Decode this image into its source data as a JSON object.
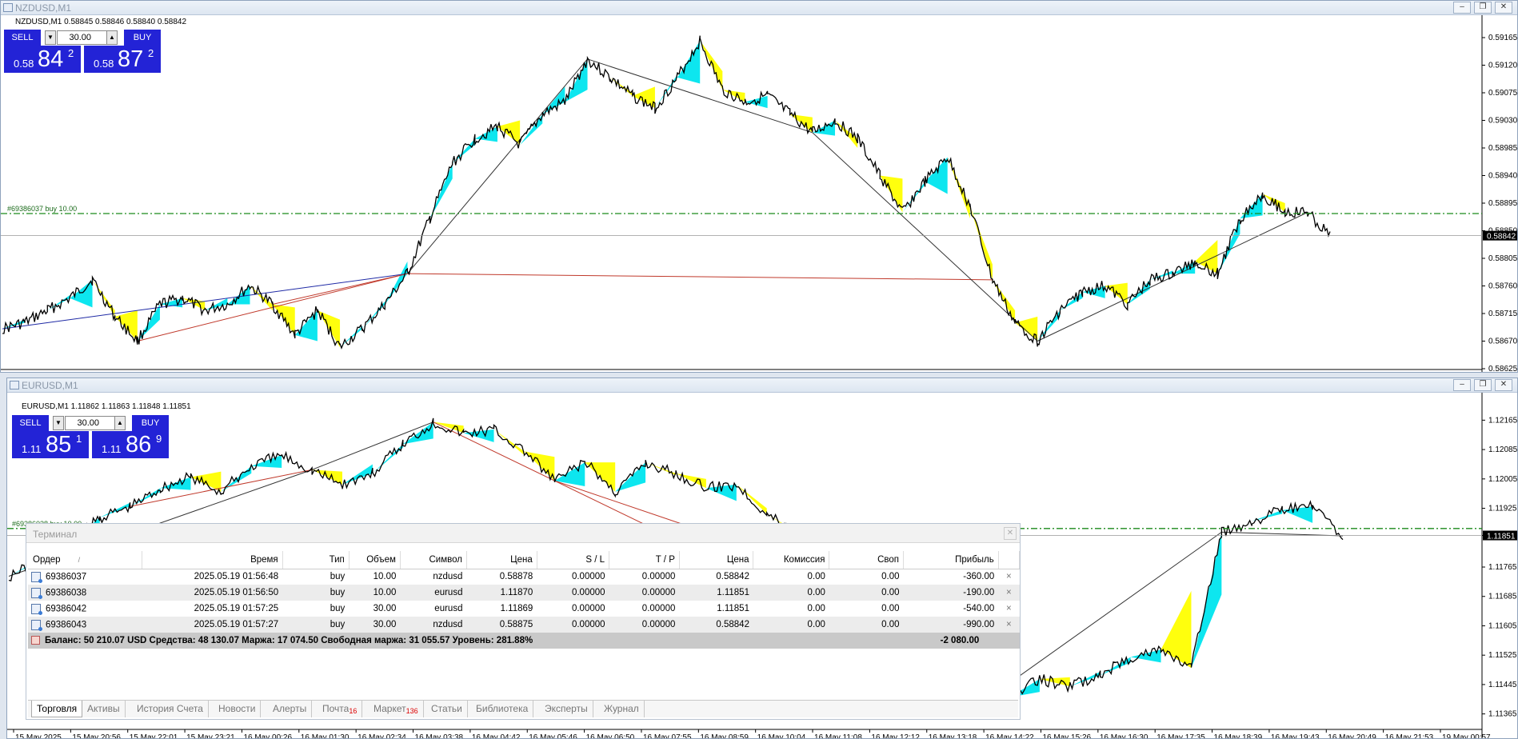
{
  "windows": {
    "top": {
      "title": "NZDUSD,M1",
      "header": "NZDUSD,M1  0.58845 0.58846 0.58840 0.58842",
      "trade_line_label": "#69386037 buy 10.00"
    },
    "bottom": {
      "title": "EURUSD,M1",
      "header": "EURUSD,M1  1.11862 1.11863 1.11848 1.11851",
      "trade_line_label": "#69386038 buy 10.00"
    }
  },
  "panels": {
    "nzd": {
      "sell": "SELL",
      "buy": "BUY",
      "volume": "30.00",
      "bid_small": "0.58",
      "bid_big": "84",
      "bid_sup": "2",
      "ask_small": "0.58",
      "ask_big": "87",
      "ask_sup": "2"
    },
    "eur": {
      "sell": "SELL",
      "buy": "BUY",
      "volume": "30.00",
      "bid_small": "1.11",
      "bid_big": "85",
      "bid_sup": "1",
      "ask_small": "1.11",
      "ask_big": "86",
      "ask_sup": "9"
    }
  },
  "chart_data": [
    {
      "type": "line",
      "title": "NZDUSD,M1",
      "y_ticks": [
        "0.59165",
        "0.59120",
        "0.59075",
        "0.59030",
        "0.58985",
        "0.58940",
        "0.58895",
        "0.58850",
        "0.58805",
        "0.58760",
        "0.58715",
        "0.58670",
        "0.58625"
      ],
      "current_price": "0.58842",
      "y_range": [
        0.58625,
        0.59165
      ],
      "series": [
        {
          "values": [
            0.5869,
            0.587,
            0.5872,
            0.5874,
            0.5877,
            0.5871,
            0.5867,
            0.5873,
            0.5874,
            0.5872,
            0.5873,
            0.5876,
            0.5873,
            0.5868,
            0.5872,
            0.5866,
            0.5869,
            0.5873,
            0.5878,
            0.5887,
            0.5896,
            0.59,
            0.5902,
            0.5899,
            0.5904,
            0.5906,
            0.5913,
            0.591,
            0.5907,
            0.5905,
            0.591,
            0.5916,
            0.5908,
            0.5906,
            0.5907,
            0.5904,
            0.5901,
            0.5903,
            0.59,
            0.5894,
            0.5888,
            0.5893,
            0.5897,
            0.5889,
            0.5877,
            0.587,
            0.5867,
            0.5872,
            0.5875,
            0.5876,
            0.5873,
            0.5877,
            0.5878,
            0.588,
            0.5878,
            0.5887,
            0.5891,
            0.5888,
            0.5888,
            0.5884
          ]
        }
      ]
    },
    {
      "type": "line",
      "title": "EURUSD,M1",
      "y_ticks": [
        "1.12165",
        "1.12085",
        "1.12005",
        "1.11925",
        "1.11851",
        "1.11765",
        "1.11685",
        "1.11605",
        "1.11525",
        "1.11445",
        "1.11365"
      ],
      "current_price": "1.11851",
      "y_range": [
        1.11325,
        1.12205
      ],
      "series": [
        {
          "values": [
            1.1174,
            1.1178,
            1.1183,
            1.119,
            1.1193,
            1.1198,
            1.1201,
            1.1197,
            1.1204,
            1.1207,
            1.1203,
            1.1199,
            1.1202,
            1.121,
            1.1216,
            1.1213,
            1.1214,
            1.1208,
            1.12,
            1.1205,
            1.1197,
            1.1205,
            1.1202,
            1.1198,
            1.1199,
            1.1191,
            1.1186,
            1.118,
            1.1172,
            1.1162,
            1.1152,
            1.1144,
            1.1139,
            1.1141,
            1.1146,
            1.1144,
            1.1147,
            1.1152,
            1.1154,
            1.1149,
            1.1186,
            1.1189,
            1.1192,
            1.1193,
            1.1185
          ]
        }
      ]
    }
  ],
  "x_ticks": [
    "15 May 2025",
    "15 May 20:56",
    "15 May 22:01",
    "15 May 23:21",
    "16 May 00:26",
    "16 May 01:30",
    "16 May 02:34",
    "16 May 03:38",
    "16 May 04:42",
    "16 May 05:46",
    "16 May 06:50",
    "16 May 07:55",
    "16 May 08:59",
    "16 May 10:04",
    "16 May 11:08",
    "16 May 12:12",
    "16 May 13:18",
    "16 May 14:22",
    "16 May 15:26",
    "16 May 16:30",
    "16 May 17:35",
    "16 May 18:39",
    "16 May 19:43",
    "16 May 20:49",
    "16 May 21:53",
    "19 May 00:57"
  ],
  "terminal": {
    "title": "Терминал",
    "columns": [
      "Ордер",
      "Время",
      "Тип",
      "Объем",
      "Символ",
      "Цена",
      "S / L",
      "T / P",
      "Цена",
      "Комиссия",
      "Своп",
      "Прибыль"
    ],
    "sort_mark": "/",
    "rows": [
      [
        "69386037",
        "2025.05.19 01:56:48",
        "buy",
        "10.00",
        "nzdusd",
        "0.58878",
        "0.00000",
        "0.00000",
        "0.58842",
        "0.00",
        "0.00",
        "-360.00"
      ],
      [
        "69386038",
        "2025.05.19 01:56:50",
        "buy",
        "10.00",
        "eurusd",
        "1.11870",
        "0.00000",
        "0.00000",
        "1.11851",
        "0.00",
        "0.00",
        "-190.00"
      ],
      [
        "69386042",
        "2025.05.19 01:57:25",
        "buy",
        "30.00",
        "eurusd",
        "1.11869",
        "0.00000",
        "0.00000",
        "1.11851",
        "0.00",
        "0.00",
        "-540.00"
      ],
      [
        "69386043",
        "2025.05.19 01:57:27",
        "buy",
        "30.00",
        "nzdusd",
        "0.58875",
        "0.00000",
        "0.00000",
        "0.58842",
        "0.00",
        "0.00",
        "-990.00"
      ]
    ],
    "close_glyph": "×",
    "summary": "Баланс: 50 210.07 USD  Средства: 48 130.07  Маржа: 17 074.50  Свободная маржа: 31 055.57  Уровень: 281.88%",
    "summary_profit": "-2 080.00",
    "tabs": [
      {
        "label": "Торговля",
        "badge": ""
      },
      {
        "label": "Активы",
        "badge": ""
      },
      {
        "label": "История Счета",
        "badge": ""
      },
      {
        "label": "Новости",
        "badge": ""
      },
      {
        "label": "Алерты",
        "badge": ""
      },
      {
        "label": "Почта",
        "badge": "16"
      },
      {
        "label": "Маркет",
        "badge": "136"
      },
      {
        "label": "Статьи",
        "badge": ""
      },
      {
        "label": "Библиотека",
        "badge": ""
      },
      {
        "label": "Эксперты",
        "badge": ""
      },
      {
        "label": "Журнал",
        "badge": ""
      }
    ]
  },
  "colors": {
    "bullish_fill": "#00e5ee",
    "bearish_fill": "#ffff00",
    "trendline_red": "#c0392b",
    "trendline_blue": "#1f2aa5",
    "order_line": "#1a8a1a",
    "panel_blue": "#2323d6"
  }
}
